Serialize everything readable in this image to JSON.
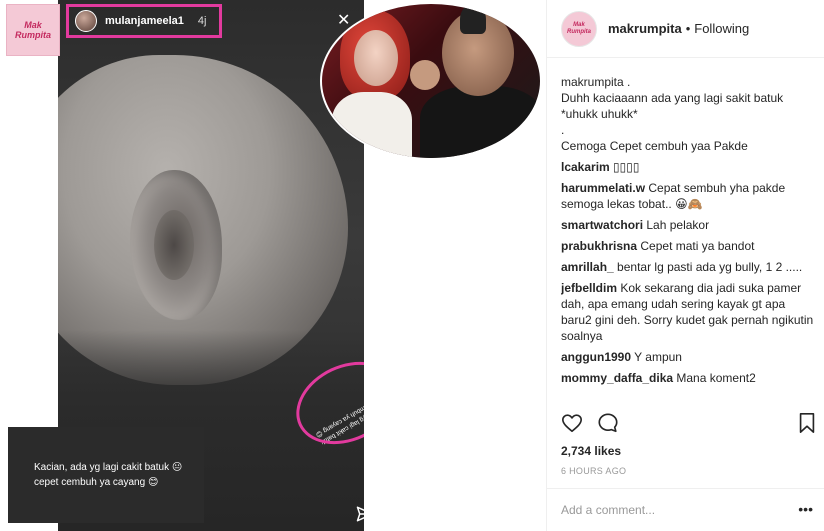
{
  "story": {
    "username": "mulanjameela1",
    "age": "4j",
    "mirror_text": "Kacian, ada yg lagi cakit batuk 😐 cepet cembuh ya cayang 😊",
    "caption": "Kacian, ada yg lagi cakit batuk 😐 cepet cembuh ya cayang 😊"
  },
  "logo": {
    "top": "Mak",
    "bottom": "Rumpita"
  },
  "post": {
    "username": "makrumpita",
    "dot": "•",
    "follow_status": "Following",
    "caption_lines": [
      "makrumpita .",
      "Duhh kaciaaann ada yang lagi sakit batuk",
      "*uhukk uhukk*",
      ".",
      "Cemoga Cepet cembuh yaa Pakde"
    ],
    "comments": [
      {
        "user": "lcakarim",
        "text": "▯▯▯▯"
      },
      {
        "user": "harummelati.w",
        "text": "Cepat sembuh yha pakde semoga lekas tobat.. 😀🙈"
      },
      {
        "user": "smartwatchori",
        "text": "Lah pelakor"
      },
      {
        "user": "prabukhrisna",
        "text": "Cepet mati ya bandot"
      },
      {
        "user": "amrillah_",
        "text": "bentar lg pasti ada yg bully, 1 2 ....."
      },
      {
        "user": "jefbelldim",
        "text": "Kok sekarang dia jadi suka pamer dah, apa emang udah sering kayak gt apa baru2 gini deh. Sorry kudet gak pernah ngikutin soalnya"
      },
      {
        "user": "anggun1990",
        "text": "Y ampun"
      },
      {
        "user": "mommy_daffa_dika",
        "text": "Mana koment2"
      }
    ],
    "likes": "2,734 likes",
    "time": "6 HOURS AGO",
    "add_comment_placeholder": "Add a comment...",
    "more": "•••"
  },
  "icons": {
    "heart": "heart-icon",
    "comment": "comment-icon",
    "bookmark": "bookmark-icon",
    "send": "send-icon",
    "close": "close-icon"
  },
  "colors": {
    "highlight": "#e23a9e",
    "brand_pink": "#c42a5f",
    "muted": "#999999"
  }
}
